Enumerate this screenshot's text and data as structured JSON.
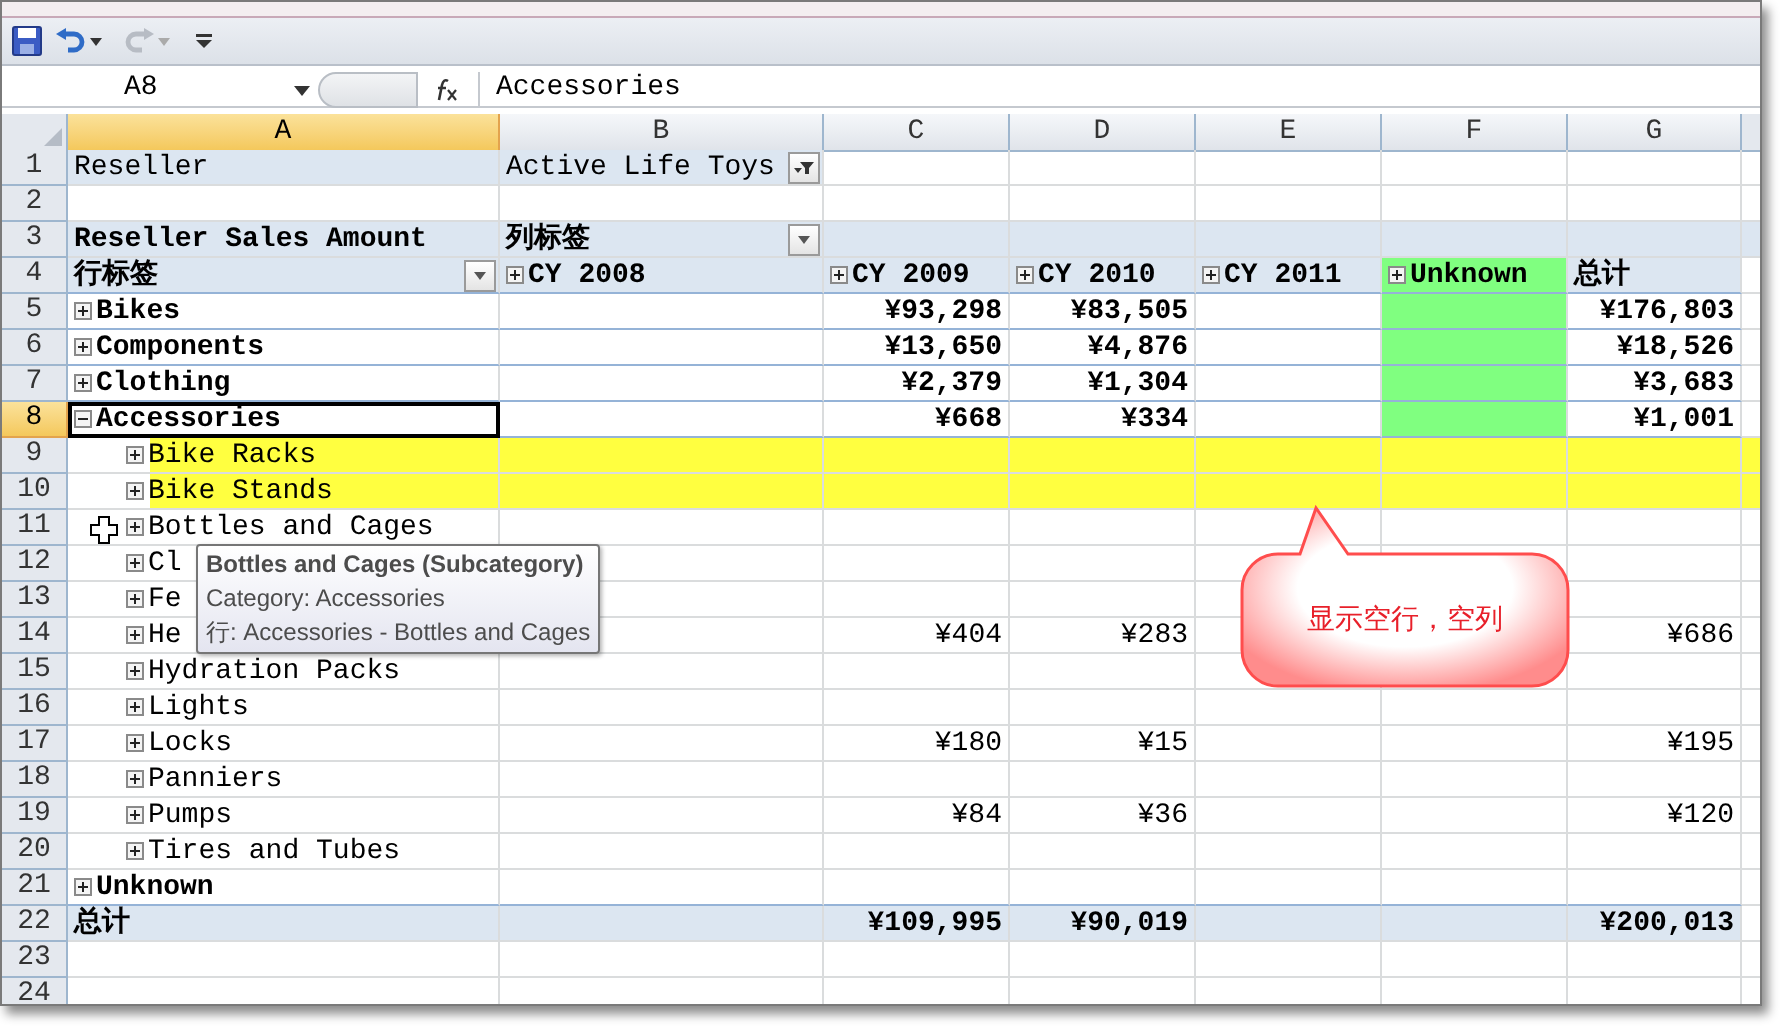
{
  "formula_bar": {
    "name_box": "A8",
    "formula": "Accessories"
  },
  "column_headers": [
    {
      "label": "A",
      "selected": true
    },
    {
      "label": "B",
      "selected": false
    },
    {
      "label": "C",
      "selected": false
    },
    {
      "label": "D",
      "selected": false
    },
    {
      "label": "E",
      "selected": false
    },
    {
      "label": "F",
      "selected": false
    },
    {
      "label": "G",
      "selected": false
    }
  ],
  "row_numbers": [
    {
      "label": "1",
      "selected": false
    },
    {
      "label": "2",
      "selected": false
    },
    {
      "label": "3",
      "selected": false
    },
    {
      "label": "4",
      "selected": false
    },
    {
      "label": "5",
      "selected": false
    },
    {
      "label": "6",
      "selected": false
    },
    {
      "label": "7",
      "selected": false
    },
    {
      "label": "8",
      "selected": true
    },
    {
      "label": "9",
      "selected": false
    },
    {
      "label": "10",
      "selected": false
    },
    {
      "label": "11",
      "selected": false
    },
    {
      "label": "12",
      "selected": false
    },
    {
      "label": "13",
      "selected": false
    },
    {
      "label": "14",
      "selected": false
    },
    {
      "label": "15",
      "selected": false
    },
    {
      "label": "16",
      "selected": false
    },
    {
      "label": "17",
      "selected": false
    },
    {
      "label": "18",
      "selected": false
    },
    {
      "label": "19",
      "selected": false
    },
    {
      "label": "20",
      "selected": false
    },
    {
      "label": "21",
      "selected": false
    },
    {
      "label": "22",
      "selected": false
    },
    {
      "label": "23",
      "selected": false
    },
    {
      "label": "24",
      "selected": false
    }
  ],
  "report_filter": {
    "label": "Reseller",
    "value": "Active Life Toys"
  },
  "pivot": {
    "measure": "Reseller Sales Amount",
    "column_labels": "列标签",
    "row_labels": "行标签",
    "total_label": "总计",
    "columns": [
      {
        "label": "CY 2008",
        "highlighted": false
      },
      {
        "label": "CY 2009",
        "highlighted": false
      },
      {
        "label": "CY 2010",
        "highlighted": false
      },
      {
        "label": "CY 2011",
        "highlighted": false
      },
      {
        "label": "Unknown",
        "highlighted": true
      }
    ],
    "rows": [
      {
        "label": "Bikes",
        "expanded": false,
        "selected": false,
        "column_highlight": true,
        "cells": {
          "c": "¥93,298",
          "d": "¥83,505",
          "g": "¥176,803"
        }
      },
      {
        "label": "Components",
        "expanded": false,
        "selected": false,
        "column_highlight": true,
        "cells": {
          "c": "¥13,650",
          "d": "¥4,876",
          "g": "¥18,526"
        }
      },
      {
        "label": "Clothing",
        "expanded": false,
        "selected": false,
        "column_highlight": true,
        "cells": {
          "c": "¥2,379",
          "d": "¥1,304",
          "g": "¥3,683"
        }
      },
      {
        "label": "Accessories",
        "expanded": true,
        "selected": true,
        "column_highlight": true,
        "cells": {
          "c": "¥668",
          "d": "¥334",
          "g": "¥1,001"
        },
        "children": [
          {
            "label": "Bike Racks",
            "expanded": false,
            "highlighted": true
          },
          {
            "label": "Bike Stands",
            "expanded": false,
            "highlighted": true
          },
          {
            "label": "Bottles and Cages",
            "expanded": false,
            "highlighted": false
          },
          {
            "label": "Cl",
            "expanded": false,
            "highlighted": false
          },
          {
            "label": "Fe",
            "expanded": false,
            "highlighted": false
          },
          {
            "label": "He",
            "expanded": false,
            "highlighted": false,
            "cells": {
              "c": "¥404",
              "d": "¥283",
              "g": "¥686"
            }
          },
          {
            "label": "Hydration Packs",
            "expanded": false,
            "highlighted": false
          },
          {
            "label": "Lights",
            "expanded": false,
            "highlighted": false
          },
          {
            "label": "Locks",
            "expanded": false,
            "highlighted": false,
            "cells": {
              "c": "¥180",
              "d": "¥15",
              "g": "¥195"
            }
          },
          {
            "label": "Panniers",
            "expanded": false,
            "highlighted": false
          },
          {
            "label": "Pumps",
            "expanded": false,
            "highlighted": false,
            "cells": {
              "c": "¥84",
              "d": "¥36",
              "g": "¥120"
            }
          },
          {
            "label": "Tires and Tubes",
            "expanded": false,
            "highlighted": false
          }
        ]
      },
      {
        "label": "Unknown",
        "expanded": false,
        "selected": false,
        "column_highlight": false
      }
    ],
    "grand_total": {
      "label": "总计",
      "cells": {
        "c": "¥109,995",
        "d": "¥90,019",
        "g": "¥200,013"
      }
    }
  },
  "tooltip": {
    "title": "Bottles and Cages (Subcategory)",
    "lines": [
      "Category: Accessories",
      "行: Accessories - Bottles and Cages"
    ]
  },
  "callout": {
    "text": "显示空行，空列"
  }
}
